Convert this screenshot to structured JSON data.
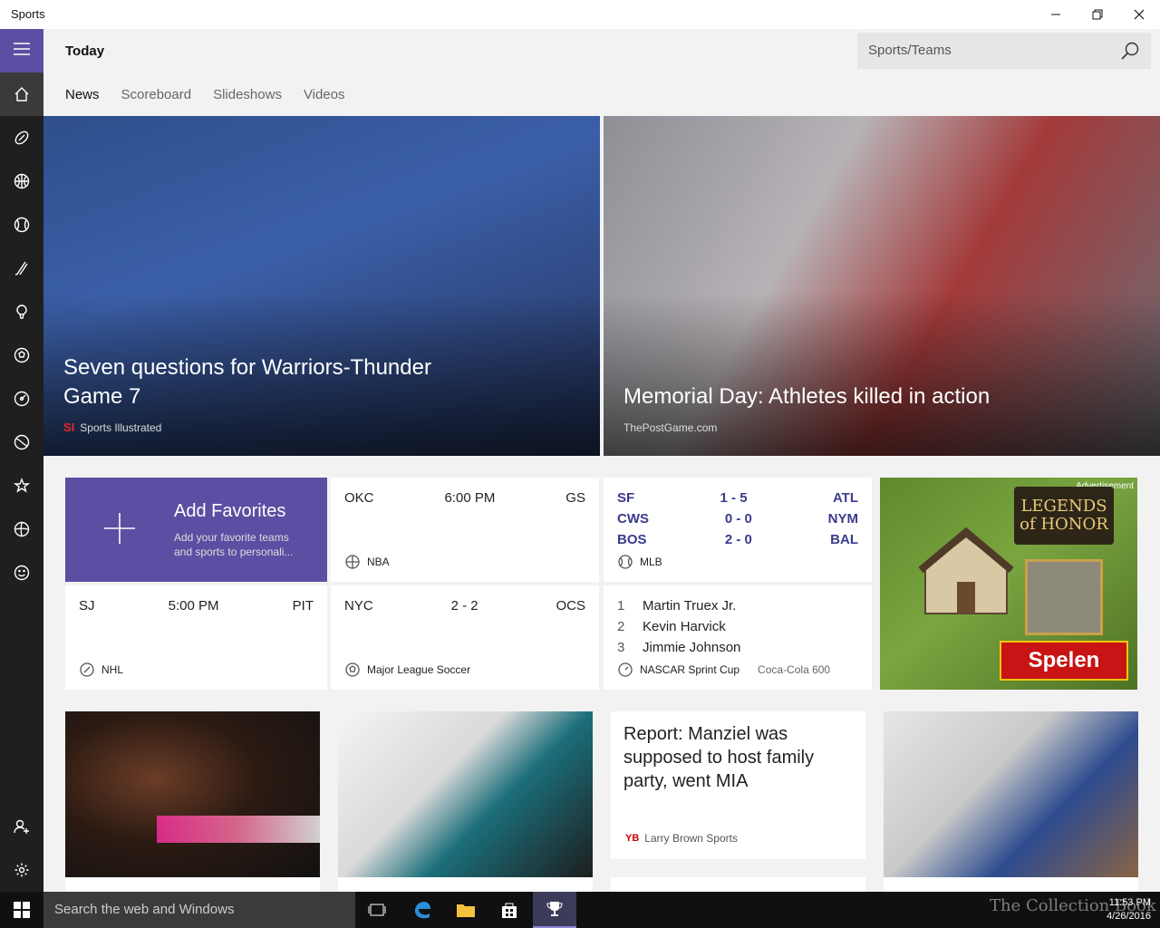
{
  "window": {
    "title": "Sports"
  },
  "header": {
    "title": "Today",
    "search_placeholder": "Sports/Teams",
    "tabs": [
      {
        "label": "News",
        "active": true
      },
      {
        "label": "Scoreboard",
        "active": false
      },
      {
        "label": "Slideshows",
        "active": false
      },
      {
        "label": "Videos",
        "active": false
      }
    ]
  },
  "rail": {
    "accent": "#5a4fa3",
    "items": [
      "home-icon",
      "football-icon",
      "basketball-icon",
      "baseball-icon",
      "hockey-icon",
      "golf-icon",
      "soccer-icon",
      "racing-icon",
      "tennis-icon",
      "favorites-icon",
      "more-sports-icon",
      "fantasy-icon",
      "add-user-icon",
      "settings-icon"
    ]
  },
  "hero": [
    {
      "headline": "Seven questions for Warriors-Thunder Game 7",
      "source_logo": "SI",
      "source": "Sports Illustrated"
    },
    {
      "headline": "Memorial Day: Athletes killed in action",
      "source": "ThePostGame.com"
    }
  ],
  "favorites": {
    "title": "Add Favorites",
    "subtitle": "Add your favorite teams and sports to personali..."
  },
  "scores": {
    "nba": {
      "home": "OKC",
      "time": "6:00 PM",
      "away": "GS",
      "league": "NBA"
    },
    "mlb": {
      "rows": [
        {
          "team1": "SF",
          "score": "1  -  5",
          "team2": "ATL"
        },
        {
          "team1": "CWS",
          "score": "0  -  0",
          "team2": "NYM"
        },
        {
          "team1": "BOS",
          "score": "2  -  0",
          "team2": "BAL"
        }
      ],
      "league": "MLB"
    },
    "nhl": {
      "home": "SJ",
      "time": "5:00 PM",
      "away": "PIT",
      "league": "NHL"
    },
    "mls": {
      "home": "NYC",
      "score": "2  -  2",
      "away": "OCS",
      "league": "Major League Soccer"
    },
    "nascar": {
      "rows": [
        {
          "rank": "1",
          "driver": "Martin Truex Jr."
        },
        {
          "rank": "2",
          "driver": "Kevin Harvick"
        },
        {
          "rank": "3",
          "driver": "Jimmie Johnson"
        }
      ],
      "league": "NASCAR Sprint Cup",
      "event": "Coca-Cola 600"
    }
  },
  "ad": {
    "label": "Advertisement",
    "brand": "LEGENDS OF HONOR",
    "cta": "Spelen"
  },
  "article": {
    "title": "Report: Manziel was supposed to host family party, went MIA",
    "source_logo": "YB",
    "source": "Larry Brown Sports"
  },
  "taskbar": {
    "search_placeholder": "Search the web and Windows",
    "time": "11:53 PM",
    "date": "4/26/2016",
    "watermark": "The Collection Book"
  }
}
